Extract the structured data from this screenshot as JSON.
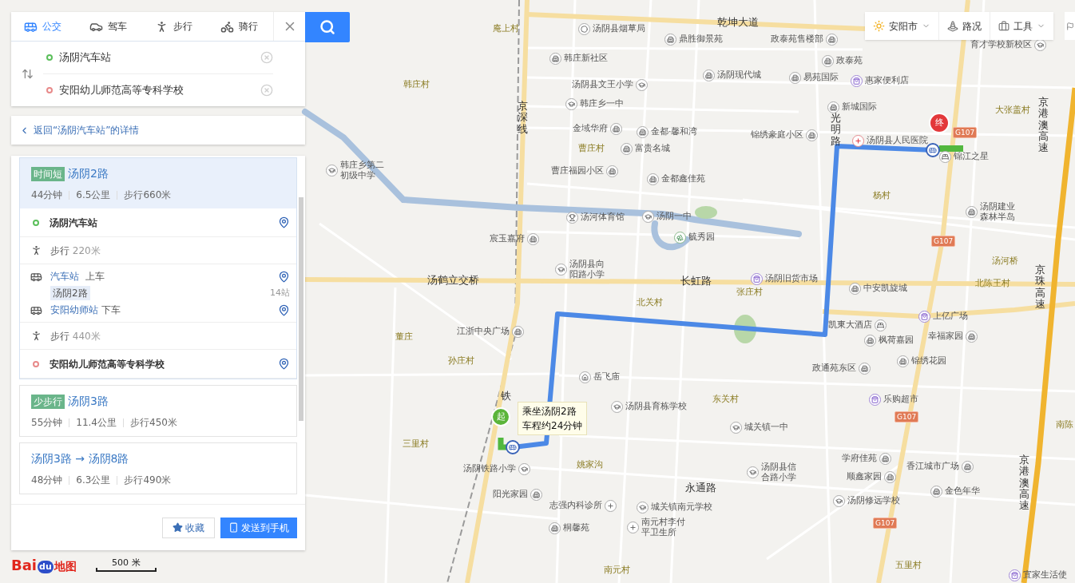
{
  "transport_tabs": [
    {
      "label": "公交",
      "kind": "bus",
      "selected": true
    },
    {
      "label": "驾车",
      "kind": "car",
      "selected": false
    },
    {
      "label": "步行",
      "kind": "walk",
      "selected": false
    },
    {
      "label": "骑行",
      "kind": "bike",
      "selected": false
    }
  ],
  "start_field": {
    "value": "汤阴汽车站"
  },
  "end_field": {
    "value": "安阳幼儿师范高等专科学校"
  },
  "back_link": "返回“汤阴汽车站”的详情",
  "routes": [
    {
      "tag": "时间短",
      "name": "汤阴2路",
      "selected": true,
      "stats": [
        "44分钟",
        "6.5公里",
        "步行660米"
      ],
      "steps": [
        {
          "kind": "start",
          "label": "汤阴汽车站"
        },
        {
          "kind": "walk",
          "label": "步行",
          "distance": "220米"
        },
        {
          "kind": "bus",
          "board_stop": "汽车站",
          "board_action": "上车",
          "line": "汤阴2路",
          "stops": "14站",
          "alight_stop": "安阳幼师站",
          "alight_action": "下车"
        },
        {
          "kind": "walk",
          "label": "步行",
          "distance": "440米"
        },
        {
          "kind": "end",
          "label": "安阳幼儿师范高等专科学校"
        }
      ]
    },
    {
      "tag": "少步行",
      "name": "汤阴3路",
      "selected": false,
      "stats": [
        "55分钟",
        "11.4公里",
        "步行450米"
      ]
    },
    {
      "name": "汤阴3路 → 汤阴8路",
      "selected": false,
      "stats": [
        "48分钟",
        "6.3公里",
        "步行490米"
      ]
    }
  ],
  "actions": [
    {
      "label": "收藏",
      "kind": "save"
    },
    {
      "label": "发送到手机",
      "kind": "send"
    }
  ],
  "map": {
    "controls": [
      {
        "label": "安阳市",
        "kind": "city"
      },
      {
        "label": "路况",
        "kind": "traffic"
      },
      {
        "label": "工具",
        "kind": "tools"
      }
    ],
    "popup": [
      "乘坐汤阴2路",
      "车程约24分钟"
    ],
    "start_marker": "起",
    "end_marker": "终",
    "scale": "500 米",
    "logo": {
      "left": "Bai",
      "badge": "du",
      "right": "地图"
    },
    "labels": [
      {
        "kind": "village",
        "text": "庵上村"
      },
      {
        "kind": "poi",
        "text": "汤阴县烟草局"
      },
      {
        "kind": "road",
        "text": "乾坤大道"
      },
      {
        "kind": "poi",
        "text": "鼎胜御景苑"
      },
      {
        "kind": "poi",
        "text": "政泰苑售楼部"
      },
      {
        "kind": "poi",
        "text": "韩庄新社区"
      },
      {
        "kind": "poi",
        "text": "育才学校新校区"
      },
      {
        "kind": "poi",
        "text": "政泰苑"
      },
      {
        "kind": "village",
        "text": "韩庄村"
      },
      {
        "kind": "poi",
        "text": "汤阴县文王小学"
      },
      {
        "kind": "poi",
        "text": "汤阴现代城"
      },
      {
        "kind": "poi",
        "text": "易苑国际"
      },
      {
        "kind": "poi",
        "text": "惠家便利店"
      },
      {
        "kind": "road_vertical",
        "text": "京深线"
      },
      {
        "kind": "poi",
        "text": "韩庄乡一中"
      },
      {
        "kind": "poi",
        "text": "新城国际"
      },
      {
        "kind": "poi",
        "text": "金域华府"
      },
      {
        "kind": "poi",
        "text": "金都·馨和湾"
      },
      {
        "kind": "poi",
        "text": "锦绣豪庭小区"
      },
      {
        "kind": "village",
        "text": "曹庄村"
      },
      {
        "kind": "poi",
        "text": "富贵名城"
      },
      {
        "kind": "road_vertical",
        "text": "光明路"
      },
      {
        "kind": "village",
        "text": "大张盖村"
      },
      {
        "kind": "poi",
        "text": "汤阴县人民医院"
      },
      {
        "kind": "shield",
        "text": "G107"
      },
      {
        "kind": "road_vertical",
        "text": "京港澳高速"
      },
      {
        "kind": "poi",
        "text": "韩庄乡第二初级中学"
      },
      {
        "kind": "poi",
        "text": "曹庄福园小区"
      },
      {
        "kind": "poi",
        "text": "锦江之星"
      },
      {
        "kind": "poi",
        "text": "金都鑫佳苑"
      },
      {
        "kind": "village",
        "text": "杨村"
      },
      {
        "kind": "poi",
        "text": "汤河体育馆"
      },
      {
        "kind": "poi",
        "text": "汤阴一中"
      },
      {
        "kind": "poi",
        "text": "汤阴建业森林半岛"
      },
      {
        "kind": "poi",
        "text": "宸玉嘉府"
      },
      {
        "kind": "poi",
        "text": "毓秀园"
      },
      {
        "kind": "shield",
        "text": "G107"
      },
      {
        "kind": "road",
        "text": "汤鹤立交桥"
      },
      {
        "kind": "poi",
        "text": "汤阴县向阳路小学"
      },
      {
        "kind": "road",
        "text": "长虹路"
      },
      {
        "kind": "poi",
        "text": "汤阴旧货市场"
      },
      {
        "kind": "village",
        "text": "汤河桥"
      },
      {
        "kind": "village",
        "text": "北关村"
      },
      {
        "kind": "village",
        "text": "张庄村"
      },
      {
        "kind": "poi",
        "text": "中安凯旋城"
      },
      {
        "kind": "village",
        "text": "北陈王村"
      },
      {
        "kind": "road_vertical",
        "text": "京珠高速"
      },
      {
        "kind": "village",
        "text": "董庄"
      },
      {
        "kind": "poi",
        "text": "江浙中央广场"
      },
      {
        "kind": "poi",
        "text": "凯東大酒店"
      },
      {
        "kind": "poi",
        "text": "枫荷嘉园"
      },
      {
        "kind": "poi",
        "text": "上亿广场"
      },
      {
        "kind": "poi",
        "text": "幸福家园"
      },
      {
        "kind": "village",
        "text": "孙庄村"
      },
      {
        "kind": "poi",
        "text": "岳飞庙"
      },
      {
        "kind": "poi",
        "text": "政通苑东区"
      },
      {
        "kind": "poi",
        "text": "锦绣花园"
      },
      {
        "kind": "road_vertical",
        "text": "铁"
      },
      {
        "kind": "poi",
        "text": "汤阴县育栋学校"
      },
      {
        "kind": "village",
        "text": "东关村"
      },
      {
        "kind": "poi",
        "text": "乐购超市"
      },
      {
        "kind": "poi",
        "text": "城关镇一中"
      },
      {
        "kind": "shield",
        "text": "G107"
      },
      {
        "kind": "village",
        "text": "南陈"
      },
      {
        "kind": "village",
        "text": "三里村"
      },
      {
        "kind": "poi",
        "text": "汤阴铁路小学"
      },
      {
        "kind": "village",
        "text": "姚家沟"
      },
      {
        "kind": "poi",
        "text": "阳光家园"
      },
      {
        "kind": "road",
        "text": "永通路"
      },
      {
        "kind": "poi",
        "text": "汤阴县信合路小学"
      },
      {
        "kind": "poi",
        "text": "学府佳苑"
      },
      {
        "kind": "poi",
        "text": "顺鑫家园"
      },
      {
        "kind": "poi",
        "text": "香江城市广场"
      },
      {
        "kind": "poi",
        "text": "志强内科诊所"
      },
      {
        "kind": "poi",
        "text": "城关镇南元学校"
      },
      {
        "kind": "poi",
        "text": "汤阴修远学校"
      },
      {
        "kind": "poi",
        "text": "金色年华"
      },
      {
        "kind": "road_vertical",
        "text": "京港澳高速"
      },
      {
        "kind": "poi",
        "text": "桐馨苑"
      },
      {
        "kind": "poi",
        "text": "南元村李付平卫生所"
      },
      {
        "kind": "shield",
        "text": "G107"
      },
      {
        "kind": "village",
        "text": "南元村"
      },
      {
        "kind": "village",
        "text": "五里村"
      },
      {
        "kind": "poi",
        "text": "宜家生活使"
      }
    ]
  }
}
